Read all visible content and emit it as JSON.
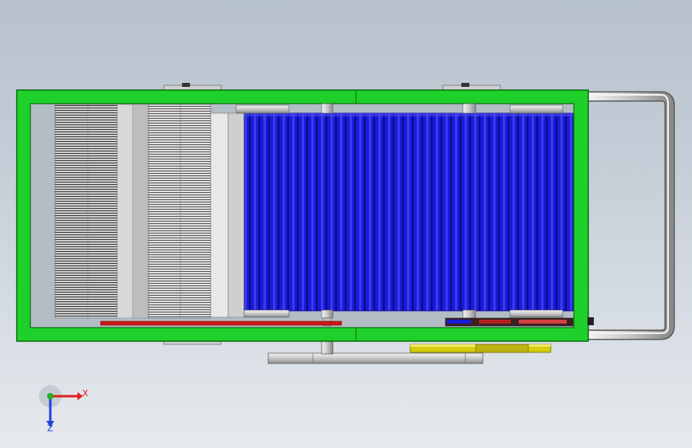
{
  "axis_triad": {
    "x_label": "X",
    "z_label": "Z"
  },
  "colors": {
    "frame": "#1ed12a",
    "frame_edge": "#0b6b10",
    "roller_blue": "#1a1ad8",
    "roller_dark": "#0d0d8a",
    "shaft_grey": "#d8d8d8",
    "plate_yellow": "#d8cc10",
    "belt_red": "#c81818",
    "axis_x": "#e02020",
    "axis_y": "#20b020",
    "axis_z": "#2040e0"
  },
  "parts": [
    "frame",
    "handle",
    "comb-roller",
    "brush-roller",
    "drive-shaft",
    "gear-plate",
    "belt"
  ]
}
